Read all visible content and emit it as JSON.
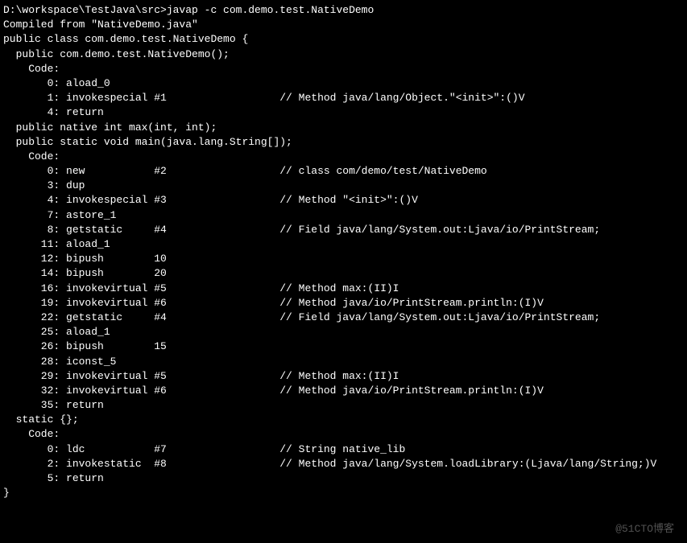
{
  "terminal": {
    "lines": [
      "D:\\workspace\\TestJava\\src>javap -c com.demo.test.NativeDemo",
      "Compiled from \"NativeDemo.java\"",
      "public class com.demo.test.NativeDemo {",
      "  public com.demo.test.NativeDemo();",
      "    Code:",
      "       0: aload_0",
      "       1: invokespecial #1                  // Method java/lang/Object.\"<init>\":()V",
      "       4: return",
      "",
      "  public native int max(int, int);",
      "",
      "  public static void main(java.lang.String[]);",
      "    Code:",
      "       0: new           #2                  // class com/demo/test/NativeDemo",
      "       3: dup",
      "       4: invokespecial #3                  // Method \"<init>\":()V",
      "       7: astore_1",
      "       8: getstatic     #4                  // Field java/lang/System.out:Ljava/io/PrintStream;",
      "      11: aload_1",
      "      12: bipush        10",
      "      14: bipush        20",
      "      16: invokevirtual #5                  // Method max:(II)I",
      "      19: invokevirtual #6                  // Method java/io/PrintStream.println:(I)V",
      "      22: getstatic     #4                  // Field java/lang/System.out:Ljava/io/PrintStream;",
      "      25: aload_1",
      "      26: bipush        15",
      "      28: iconst_5",
      "      29: invokevirtual #5                  // Method max:(II)I",
      "      32: invokevirtual #6                  // Method java/io/PrintStream.println:(I)V",
      "      35: return",
      "",
      "  static {};",
      "    Code:",
      "       0: ldc           #7                  // String native_lib",
      "       2: invokestatic  #8                  // Method java/lang/System.loadLibrary:(Ljava/lang/String;)V",
      "       5: return",
      "}"
    ]
  },
  "watermark": "@51CTO博客"
}
